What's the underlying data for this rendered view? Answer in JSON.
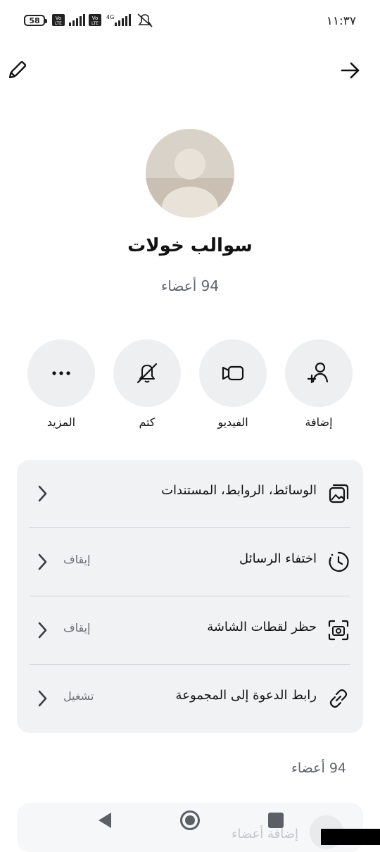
{
  "status_bar": {
    "battery": "58",
    "time": "١١:٣٧",
    "network_label": "4G",
    "volte_label": "Vo LTE"
  },
  "header": {
    "back_icon": "arrow-right-icon",
    "edit_icon": "pencil-icon"
  },
  "group": {
    "name": "سوالب خولات",
    "members_summary": "94 أعضاء"
  },
  "actions": [
    {
      "label": "إضافة",
      "icon": "add-person-icon"
    },
    {
      "label": "الفيديو",
      "icon": "video-icon"
    },
    {
      "label": "كتم",
      "icon": "bell-off-icon"
    },
    {
      "label": "المزيد",
      "icon": "more-icon"
    }
  ],
  "settings": [
    {
      "title": "الوسائط، الروابط، المستندات",
      "value": "",
      "icon": "media-gallery-icon"
    },
    {
      "title": "اختفاء الرسائل",
      "value": "إيقاف",
      "icon": "timer-icon"
    },
    {
      "title": "حظر لقطات الشاشة",
      "value": "إيقاف",
      "icon": "screenshot-icon"
    },
    {
      "title": "رابط الدعوة إلى المجموعة",
      "value": "تشغيل",
      "icon": "link-icon"
    }
  ],
  "members": {
    "count_label": "94 أعضاء",
    "add_label": "إضافة أعضاء"
  },
  "colors": {
    "card_bg": "#f1f2f4",
    "circle_bg": "#eeeff1",
    "secondary_text": "#60646c"
  }
}
